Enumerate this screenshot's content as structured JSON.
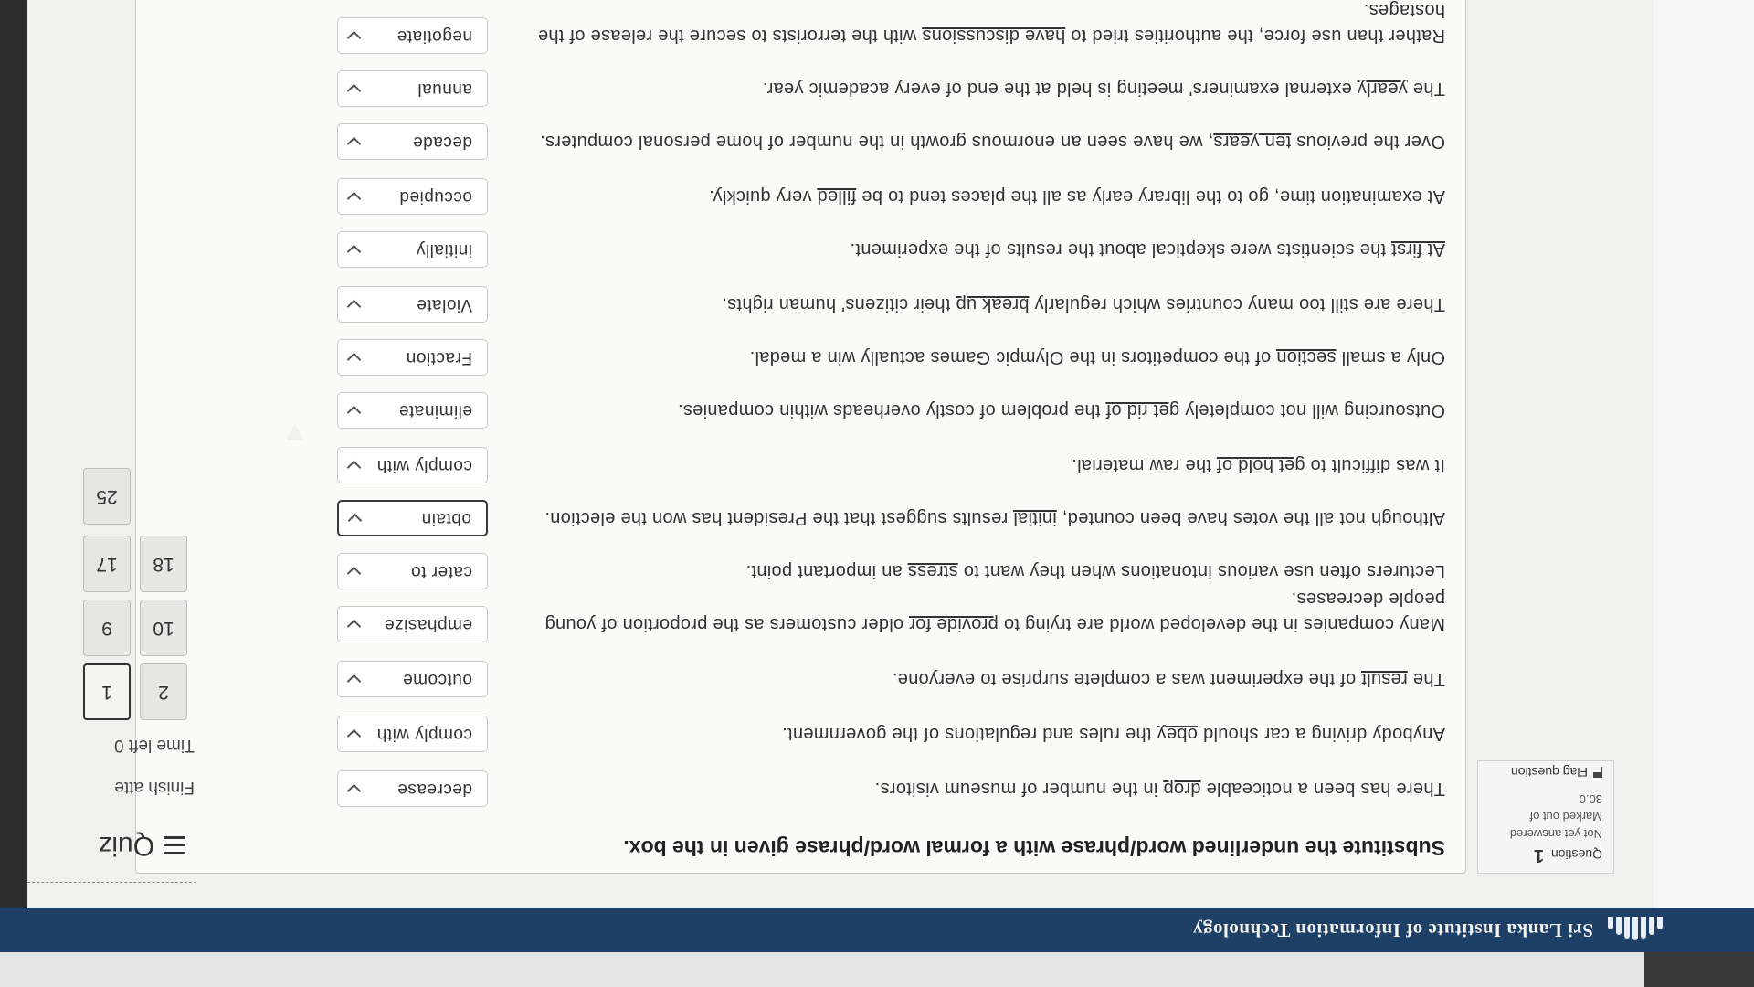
{
  "header": {
    "site_name": "Sri Lanka Institute of Information Technology"
  },
  "quiz_nav": {
    "title": "Quiz",
    "finish_attempt": "Finish atte",
    "time_left": "Time left 0",
    "question_buttons": [
      "1",
      "2",
      "9",
      "10",
      "17",
      "18",
      "25"
    ],
    "current_question": "1"
  },
  "question_info": {
    "question_label": "Question",
    "question_number": "1",
    "status": "Not yet answered",
    "marked_out_of": "Marked out of",
    "mark_value": "30.0",
    "flag_label": "Flag question"
  },
  "instruction": "Substitute the underlined word/phrase with a formal word/phrase given in the box.",
  "questions": [
    {
      "before": "There has been a noticeable ",
      "underline": "drop",
      "after": " in the number of museum visitors.",
      "answer": "decrease"
    },
    {
      "before": "Anybody driving a car should ",
      "underline": "obey",
      "after": " the rules and regulations of the government.",
      "answer": "comply with"
    },
    {
      "before": "The ",
      "underline": "result",
      "after": " of the experiment was a complete surprise to everyone.",
      "answer": "outcome"
    },
    {
      "before": "Many companies in the developed world are trying to ",
      "underline": "provide for",
      "after": " older customers as the proportion of young people decreases.",
      "answer": "emphasize"
    },
    {
      "before": "Lecturers often use various intonations when they want to ",
      "underline": "stress",
      "after": " an important point.",
      "answer": "cater to"
    },
    {
      "before": "Although not all the votes have been counted, ",
      "underline": "initial",
      "after": " results suggest that the President has won the election.",
      "answer": "obtain"
    },
    {
      "before": "It was difficult to ",
      "underline": "get hold of",
      "after": " the raw material.",
      "answer": "comply with"
    },
    {
      "before": "Outsourcing will not completely ",
      "underline": "get rid of",
      "after": " the problem of costly overheads within companies.",
      "answer": "eliminate"
    },
    {
      "before": "Only a small ",
      "underline": "section",
      "after": " of the competitors in the Olympic Games actually win a medal.",
      "answer": "Fraction"
    },
    {
      "before": "There are still too many countries which regularly ",
      "underline": "break up",
      "after": " their citizens' human rights.",
      "answer": "Violate"
    },
    {
      "before": "",
      "underline": "At first",
      "after": " the scientists were skeptical about the results of the experiment.",
      "answer": "initially"
    },
    {
      "before": "At examination time, go to the library early as all the places tend to be ",
      "underline": "filled",
      "after": " very quickly.",
      "answer": "occupied"
    },
    {
      "before": "Over the previous ",
      "underline": "ten years",
      "after": ", we have seen an enormous growth in the number of home personal computers.",
      "answer": "decade"
    },
    {
      "before": "The ",
      "underline": "yearly",
      "after": " external examiners' meeting is held at the end of every academic year.",
      "answer": "annual"
    },
    {
      "before": "Rather than use force, the authorities tried to ",
      "underline": "have discussions",
      "after": " with the terrorists to secure the release of the hostages.",
      "answer": "negotiate"
    }
  ]
}
